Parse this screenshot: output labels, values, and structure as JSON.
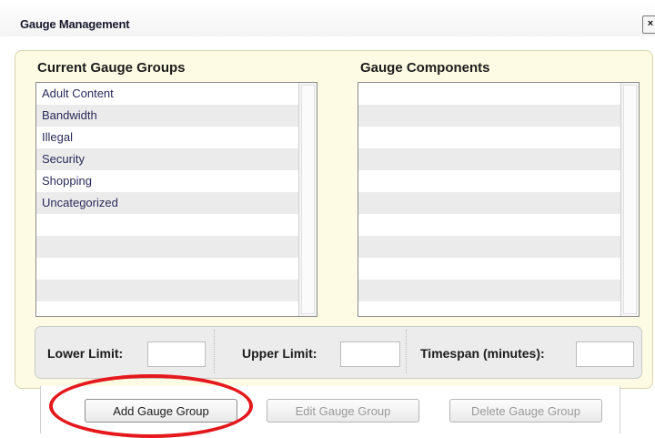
{
  "dialog": {
    "title": "Gauge Management",
    "close_label": "×"
  },
  "groups": {
    "heading": "Current Gauge Groups",
    "items": [
      "Adult Content",
      "Bandwidth",
      "Illegal",
      "Security",
      "Shopping",
      "Uncategorized"
    ]
  },
  "components": {
    "heading": "Gauge Components",
    "items": []
  },
  "limits": {
    "lower_label": "Lower Limit:",
    "lower_value": "",
    "upper_label": "Upper Limit:",
    "upper_value": "",
    "timespan_label": "Timespan (minutes):",
    "timespan_value": ""
  },
  "buttons": {
    "add": "Add Gauge Group",
    "edit": "Edit Gauge Group",
    "delete": "Delete Gauge Group"
  },
  "colors": {
    "panel": "#fdfbe3",
    "highlight": "#e5191d"
  }
}
